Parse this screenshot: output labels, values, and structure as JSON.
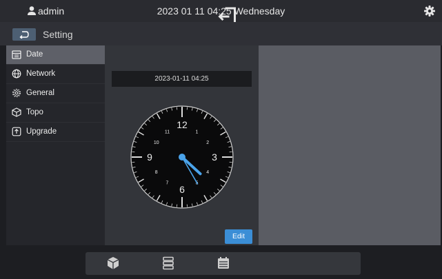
{
  "topbar": {
    "username": "admin",
    "datetime": "2023 01 11 04:25 Wednesday"
  },
  "header": {
    "title": "Setting"
  },
  "sidebar": {
    "items": [
      {
        "label": "Date",
        "icon": "calendar-icon",
        "active": true
      },
      {
        "label": "Network",
        "icon": "globe-icon",
        "active": false
      },
      {
        "label": "General",
        "icon": "gear-icon",
        "active": false
      },
      {
        "label": "Topo",
        "icon": "cube-icon",
        "active": false
      },
      {
        "label": "Upgrade",
        "icon": "upload-icon",
        "active": false
      }
    ]
  },
  "date_panel": {
    "datetime_value": "2023-01-11 04:25",
    "edit_label": "Edit",
    "clock": {
      "numbers": [
        "12",
        "1",
        "2",
        "3",
        "4",
        "5",
        "6",
        "7",
        "8",
        "9",
        "10",
        "11"
      ],
      "hour": 4,
      "minute": 25
    }
  },
  "dock": {
    "icons": [
      "box-icon",
      "server-icon",
      "calendar-icon"
    ]
  },
  "colors": {
    "accent": "#3b8ed6",
    "active_item": "#5e6068",
    "clock_hand": "#4aa3ea"
  }
}
